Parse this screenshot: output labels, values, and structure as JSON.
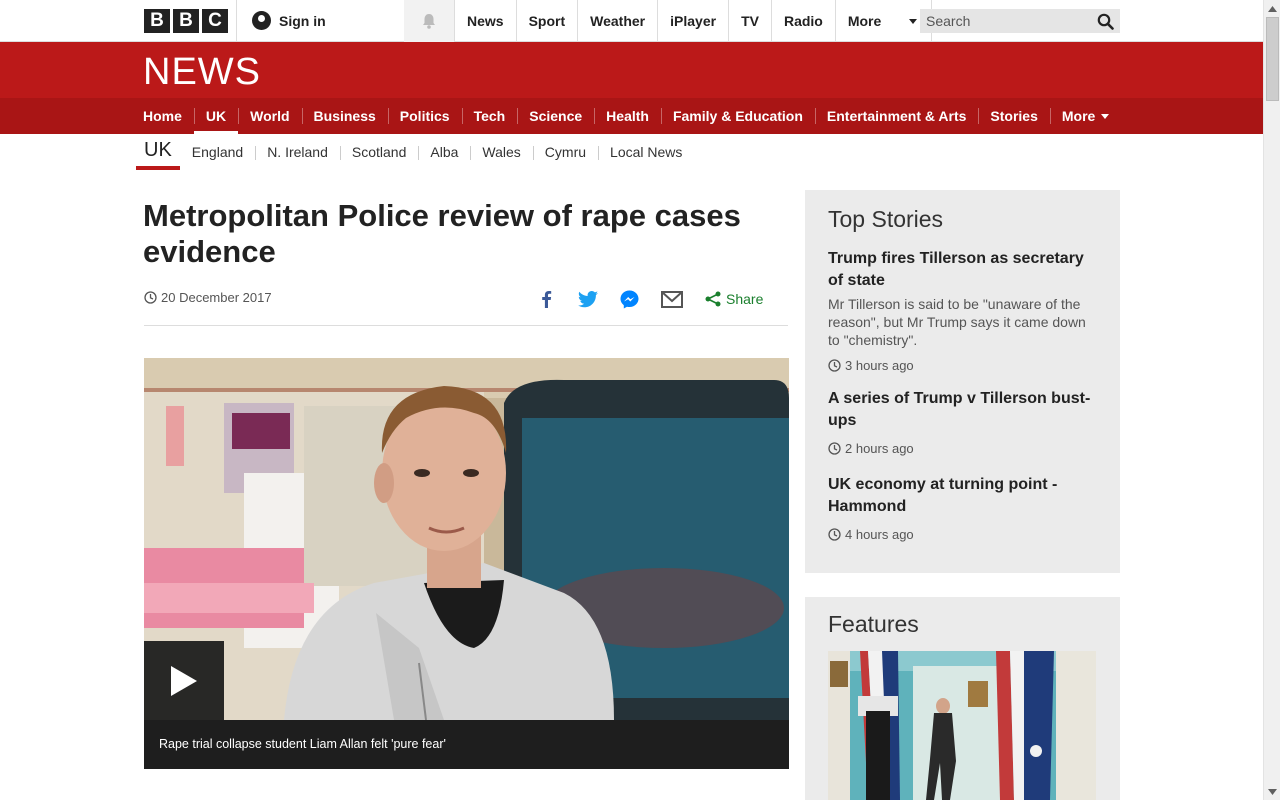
{
  "topbar": {
    "logo_letters": [
      "B",
      "B",
      "C"
    ],
    "signin_label": "Sign in",
    "nav": [
      "News",
      "Sport",
      "Weather",
      "iPlayer",
      "TV",
      "Radio",
      "More"
    ],
    "search_placeholder": "Search"
  },
  "news_header": {
    "brand": "NEWS",
    "sections": [
      {
        "label": "Home",
        "active": false
      },
      {
        "label": "UK",
        "active": true
      },
      {
        "label": "World",
        "active": false
      },
      {
        "label": "Business",
        "active": false
      },
      {
        "label": "Politics",
        "active": false
      },
      {
        "label": "Tech",
        "active": false
      },
      {
        "label": "Science",
        "active": false
      },
      {
        "label": "Health",
        "active": false
      },
      {
        "label": "Family & Education",
        "active": false
      },
      {
        "label": "Entertainment & Arts",
        "active": false
      },
      {
        "label": "Stories",
        "active": false
      },
      {
        "label": "More",
        "active": false
      }
    ]
  },
  "subnav": {
    "current": "UK",
    "items": [
      "England",
      "N. Ireland",
      "Scotland",
      "Alba",
      "Wales",
      "Cymru",
      "Local News"
    ]
  },
  "article": {
    "headline": "Metropolitan Police review of rape cases evidence",
    "date": "20 December 2017",
    "share_label": "Share",
    "media_caption": "Rape trial collapse student Liam Allan felt 'pure fear'"
  },
  "top_stories": {
    "title": "Top Stories",
    "stories": [
      {
        "title": "Trump fires Tillerson as secretary of state",
        "summary": "Mr Tillerson is said to be \"unaware of the reason\", but Mr Trump says it came down to \"chemistry\".",
        "time": "3 hours ago"
      },
      {
        "title": "A series of Trump v Tillerson bust-ups",
        "summary": "",
        "time": "2 hours ago"
      },
      {
        "title": "UK economy at turning point - Hammond",
        "summary": "",
        "time": "4 hours ago"
      }
    ]
  },
  "features": {
    "title": "Features"
  },
  "colors": {
    "brand_red": "#bb1919",
    "section_red": "#a91515",
    "share_green": "#1a7f2d",
    "facebook": "#3b5998",
    "twitter": "#1da1f2",
    "messenger": "#0084ff"
  }
}
